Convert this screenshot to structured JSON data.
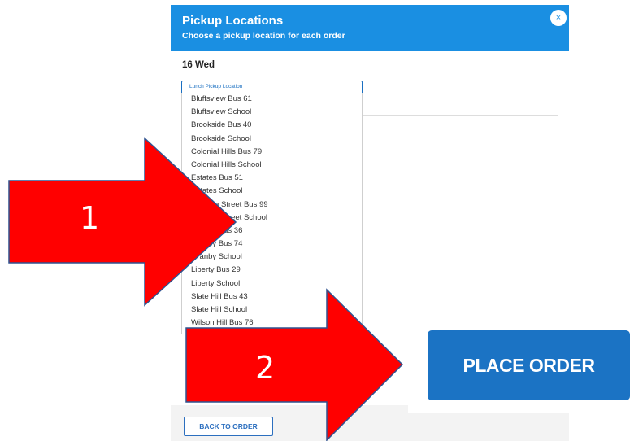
{
  "modal": {
    "title": "Pickup Locations",
    "subtitle": "Choose a pickup location for each order",
    "close_icon": "×",
    "day": "16 Wed",
    "field_caption": "Lunch Pickup Location",
    "options": [
      "Bluffsview Bus 61",
      "Bluffsview School",
      "Brookside Bus 40",
      "Brookside School",
      "Colonial Hills Bus 79",
      "Colonial Hills School",
      "Estates Bus 51",
      "Estates School",
      "Evening Street Bus 99",
      "Evening Street School",
      "Granby Bus 36",
      "Granby Bus 74",
      "Granby School",
      "Liberty Bus 29",
      "Liberty School",
      "Slate Hill Bus 43",
      "Slate Hill School",
      "Wilson Hill Bus 76"
    ],
    "back_button": "BACK TO ORDER"
  },
  "callout": {
    "place_order_button": "PLACE ORDER",
    "arrow_1_label": "1",
    "arrow_2_label": "2"
  },
  "colors": {
    "header": "#1a8fe2",
    "place_order": "#1b73c4",
    "arrow_fill": "#ff0000",
    "arrow_stroke": "#2f528f"
  }
}
